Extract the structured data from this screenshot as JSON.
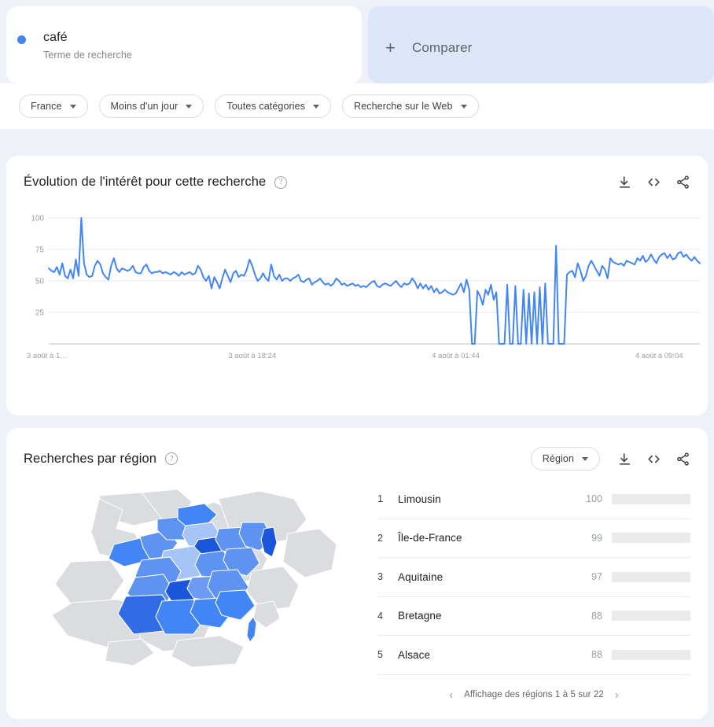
{
  "term": {
    "name": "café",
    "type_label": "Terme de recherche",
    "dot_color": "#4285f4"
  },
  "compare": {
    "label": "Comparer",
    "plus_icon": "plus-icon",
    "bg_color": "#dce6f8"
  },
  "filters": [
    {
      "label": "France",
      "icon": "chevron-down-icon"
    },
    {
      "label": "Moins d'un jour",
      "icon": "chevron-down-icon"
    },
    {
      "label": "Toutes catégories",
      "icon": "chevron-down-icon"
    },
    {
      "label": "Recherche sur le Web",
      "icon": "chevron-down-icon"
    }
  ],
  "interest_card": {
    "title": "Évolution de l'intérêt pour cette recherche",
    "help_icon": "help-circle-icon",
    "help_glyph": "?",
    "actions": [
      {
        "name": "download-icon"
      },
      {
        "name": "embed-code-icon"
      },
      {
        "name": "share-icon"
      }
    ]
  },
  "region_card": {
    "title": "Recherches par région",
    "help_icon": "help-circle-icon",
    "help_glyph": "?",
    "selector": {
      "label": "Région",
      "icon": "chevron-down-icon"
    },
    "actions": [
      {
        "name": "download-icon"
      },
      {
        "name": "embed-code-icon"
      },
      {
        "name": "share-icon"
      }
    ],
    "rows": [
      {
        "rank": "1",
        "name": "Limousin",
        "value": "100",
        "pct": 100
      },
      {
        "rank": "2",
        "name": "Île-de-France",
        "value": "99",
        "pct": 99
      },
      {
        "rank": "3",
        "name": "Aquitaine",
        "value": "97",
        "pct": 97
      },
      {
        "rank": "4",
        "name": "Bretagne",
        "value": "88",
        "pct": 88
      },
      {
        "rank": "5",
        "name": "Alsace",
        "value": "88",
        "pct": 88
      }
    ],
    "pagination": {
      "prev_icon": "chevron-left-icon",
      "next_icon": "chevron-right-icon",
      "text": "Affichage des régions 1 à 5 sur 22"
    },
    "map": {
      "name": "france-choropleth-map",
      "colors": {
        "land": "#dadce0",
        "sea": "#ffffff",
        "low": "#a6c4f6",
        "mid": "#6b9bf2",
        "high": "#4285f4",
        "max": "#1a56db"
      }
    }
  },
  "chart_data": {
    "type": "line",
    "title": "Évolution de l'intérêt pour cette recherche",
    "xlabel": "",
    "ylabel": "",
    "ylim": [
      0,
      100
    ],
    "yticks": [
      25,
      50,
      75,
      100
    ],
    "ytick_labels": [
      "25",
      "50",
      "75",
      "100"
    ],
    "grid": true,
    "legend": "none",
    "line_color": "#4285f4",
    "xtick_labels": [
      "3 août à 1…",
      "3 août à 18:24",
      "4 août à 01:44",
      "4 août à 09:04"
    ],
    "xtick_positions": [
      0,
      0.3125,
      0.625,
      0.9375
    ],
    "series": [
      {
        "name": "café",
        "values": [
          60,
          58,
          57,
          61,
          55,
          64,
          54,
          52,
          59,
          52,
          67,
          54,
          100,
          64,
          55,
          53,
          54,
          62,
          66,
          63,
          56,
          53,
          51,
          62,
          68,
          60,
          57,
          60,
          59,
          58,
          59,
          62,
          57,
          56,
          56,
          61,
          63,
          58,
          56,
          57,
          57,
          58,
          56,
          57,
          56,
          55,
          57,
          56,
          54,
          57,
          55,
          56,
          57,
          55,
          56,
          62,
          59,
          53,
          50,
          54,
          44,
          53,
          49,
          44,
          52,
          59,
          54,
          49,
          56,
          58,
          53,
          55,
          54,
          59,
          67,
          62,
          55,
          50,
          52,
          56,
          52,
          50,
          63,
          54,
          51,
          55,
          50,
          52,
          52,
          50,
          52,
          53,
          55,
          50,
          49,
          51,
          52,
          47,
          49,
          50,
          52,
          49,
          47,
          48,
          46,
          48,
          52,
          50,
          47,
          48,
          46,
          47,
          48,
          46,
          47,
          45,
          46,
          45,
          47,
          49,
          50,
          46,
          45,
          47,
          48,
          47,
          46,
          48,
          50,
          47,
          45,
          48,
          47,
          48,
          52,
          49,
          44,
          48,
          44,
          47,
          43,
          46,
          41,
          44,
          40,
          41,
          43,
          41,
          40,
          39,
          40,
          44,
          48,
          41,
          51,
          43,
          0,
          0,
          42,
          38,
          31,
          43,
          39,
          47,
          35,
          41,
          0,
          0,
          0,
          47,
          0,
          0,
          46,
          0,
          0,
          43,
          0,
          40,
          0,
          41,
          0,
          45,
          0,
          48,
          0,
          0,
          0,
          78,
          0,
          0,
          0,
          55,
          57,
          58,
          53,
          64,
          58,
          50,
          54,
          62,
          66,
          62,
          58,
          54,
          62,
          59,
          52,
          68,
          65,
          64,
          63,
          64,
          62,
          66,
          65,
          64,
          63,
          68,
          66,
          70,
          65,
          67,
          71,
          67,
          64,
          69,
          71,
          72,
          68,
          71,
          67,
          68,
          72,
          73,
          69,
          71,
          68,
          66,
          69,
          66,
          64
        ]
      }
    ]
  }
}
